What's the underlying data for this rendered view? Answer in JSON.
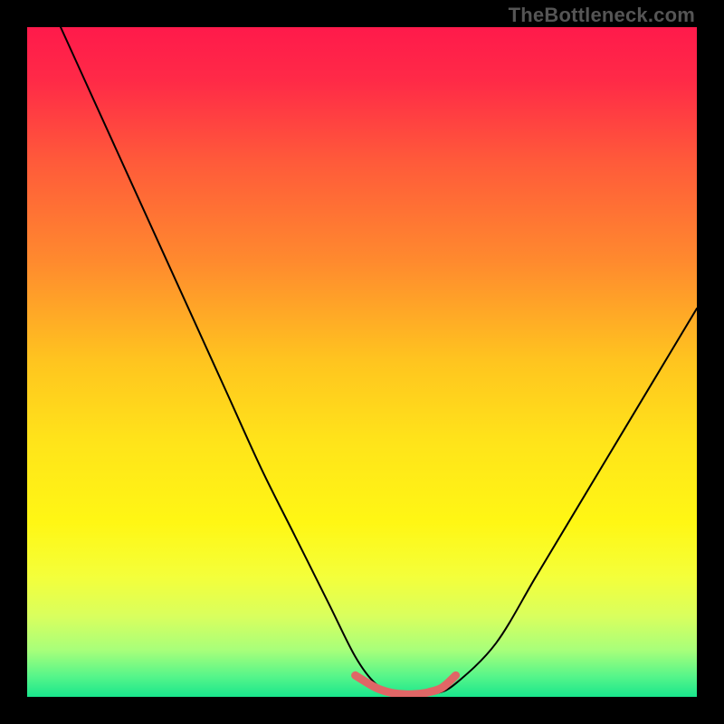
{
  "watermark": "TheBottleneck.com",
  "chart_data": {
    "type": "line",
    "title": "",
    "xlabel": "",
    "ylabel": "",
    "xlim": [
      0,
      100
    ],
    "ylim": [
      0,
      100
    ],
    "grid": false,
    "series": [
      {
        "name": "bottleneck-curve",
        "x": [
          5,
          10,
          15,
          20,
          25,
          30,
          35,
          40,
          45,
          49,
          52,
          55,
          58,
          61,
          64,
          70,
          76,
          82,
          88,
          94,
          100
        ],
        "y": [
          100,
          89,
          78,
          67,
          56,
          45,
          34,
          24,
          14,
          6,
          2,
          0.5,
          0.3,
          0.5,
          2,
          8,
          18,
          28,
          38,
          48,
          58
        ]
      },
      {
        "name": "bottom-highlight",
        "x": [
          49,
          52,
          54,
          56,
          58,
          60,
          62,
          64
        ],
        "y": [
          3.2,
          1.4,
          0.7,
          0.4,
          0.4,
          0.7,
          1.4,
          3.2
        ]
      }
    ],
    "gradient_stops": [
      {
        "offset": 0.0,
        "color": "#ff1a4b"
      },
      {
        "offset": 0.08,
        "color": "#ff2a47"
      },
      {
        "offset": 0.2,
        "color": "#ff5a3a"
      },
      {
        "offset": 0.35,
        "color": "#ff8a2e"
      },
      {
        "offset": 0.5,
        "color": "#ffc51f"
      },
      {
        "offset": 0.62,
        "color": "#ffe41a"
      },
      {
        "offset": 0.74,
        "color": "#fff714"
      },
      {
        "offset": 0.82,
        "color": "#f4ff3a"
      },
      {
        "offset": 0.88,
        "color": "#d9ff5e"
      },
      {
        "offset": 0.93,
        "color": "#a8ff7a"
      },
      {
        "offset": 0.97,
        "color": "#55f58a"
      },
      {
        "offset": 1.0,
        "color": "#19e68c"
      }
    ],
    "colors": {
      "curve": "#000000",
      "highlight": "#e06666"
    }
  }
}
